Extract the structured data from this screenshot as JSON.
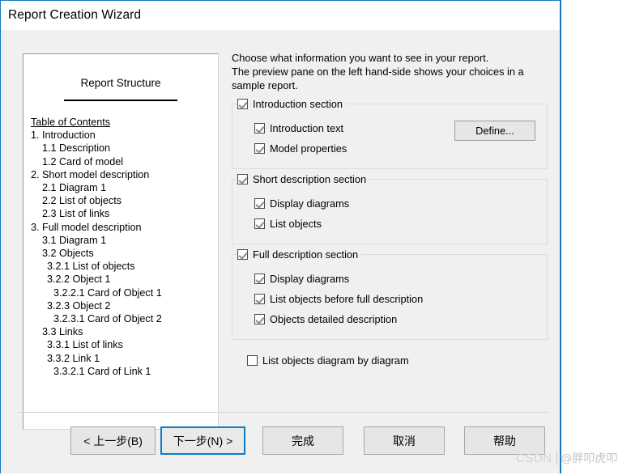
{
  "window": {
    "title": "Report Creation Wizard"
  },
  "preview": {
    "title": "Report Structure",
    "toc_heading": "Table of Contents",
    "toc": [
      {
        "label": "1. Introduction",
        "level": 0
      },
      {
        "label": "1.1 Description",
        "level": 1
      },
      {
        "label": "1.2 Card of model",
        "level": 1
      },
      {
        "label": "2. Short model description",
        "level": 0
      },
      {
        "label": "2.1 Diagram 1",
        "level": 1
      },
      {
        "label": "2.2 List of objects",
        "level": 1
      },
      {
        "label": "2.3 List of links",
        "level": 1
      },
      {
        "label": "3. Full model description",
        "level": 0
      },
      {
        "label": "3.1 Diagram 1",
        "level": 1
      },
      {
        "label": "3.2 Objects",
        "level": 1
      },
      {
        "label": "3.2.1 List of objects",
        "level": 2
      },
      {
        "label": "3.2.2 Object 1",
        "level": 2
      },
      {
        "label": "3.2.2.1 Card of Object 1",
        "level": 3
      },
      {
        "label": "3.2.3 Object 2",
        "level": 2
      },
      {
        "label": "3.2.3.1 Card of Object 2",
        "level": 3
      },
      {
        "label": "3.3 Links",
        "level": 1
      },
      {
        "label": "3.3.1 List of links",
        "level": 2
      },
      {
        "label": "3.3.2 Link 1",
        "level": 2
      },
      {
        "label": "3.3.2.1 Card of Link 1",
        "level": 3
      }
    ]
  },
  "instructions": {
    "line1": "Choose what information you want to see in your report.",
    "line2": "The preview pane on the left hand-side shows your choices in a",
    "line3": "sample report."
  },
  "groups": {
    "introduction": {
      "legend": "Introduction section",
      "legend_checked": true,
      "items": [
        {
          "label": "Introduction text",
          "checked": true
        },
        {
          "label": "Model properties",
          "checked": true
        }
      ],
      "define_button": "Define..."
    },
    "short_description": {
      "legend": "Short description section",
      "legend_checked": true,
      "items": [
        {
          "label": "Display diagrams",
          "checked": true
        },
        {
          "label": "List objects",
          "checked": true
        }
      ]
    },
    "full_description": {
      "legend": "Full description section",
      "legend_checked": true,
      "items": [
        {
          "label": "Display diagrams",
          "checked": true
        },
        {
          "label": "List objects before full description",
          "checked": true
        },
        {
          "label": "Objects detailed description",
          "checked": true
        }
      ]
    }
  },
  "standalone_option": {
    "label": "List objects diagram by diagram",
    "checked": false
  },
  "buttons": {
    "back": "< 上一步(B)",
    "next": "下一步(N) >",
    "finish": "完成",
    "cancel": "取消",
    "help": "帮助"
  },
  "watermark": {
    "brand": "CSDN",
    "user": "@胖叩虎叩"
  },
  "colors": {
    "window_border": "#1579c2",
    "focus_border": "#0d7cc4",
    "dialog_bg": "#f0f0f0",
    "button_face": "#e6e6e6"
  }
}
